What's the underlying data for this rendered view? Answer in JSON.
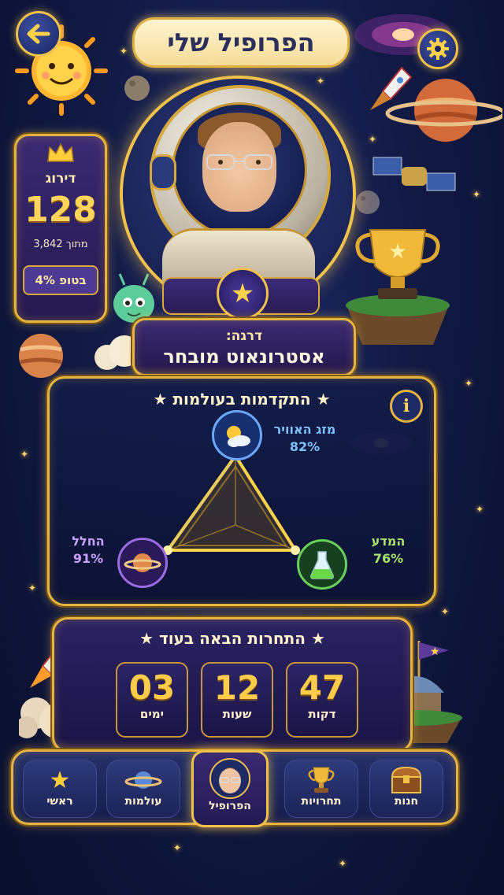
{
  "header": {
    "title": "הפרופיל שלי",
    "back_icon": "arrow-left-icon",
    "settings_icon": "gear-icon"
  },
  "rank": {
    "label": "דירוג",
    "value": "128",
    "out_of": "מתוך 3,842",
    "top_percent": "בטופ 4%"
  },
  "player": {
    "rank_title_label": "דרגה:",
    "rank_title": "אסטרונאוט מובחר"
  },
  "worlds_progress": {
    "title": "★ התקדמות בעולמות ★",
    "info_label": "i",
    "weather": {
      "name": "מזג האוויר",
      "percent": "82%",
      "value": 82,
      "color": "#7fc0ff"
    },
    "space": {
      "name": "החלל",
      "percent": "91%",
      "value": 91,
      "color": "#c9a2ff"
    },
    "science": {
      "name": "המדע",
      "percent": "76%",
      "value": 76,
      "color": "#a6e36a"
    }
  },
  "countdown": {
    "title": "★ התחרות הבאה בעוד ★",
    "days": {
      "value": "03",
      "label": "ימים"
    },
    "hours": {
      "value": "12",
      "label": "שעות"
    },
    "minutes": {
      "value": "47",
      "label": "דקות"
    }
  },
  "nav": {
    "items": [
      {
        "label": "חנות",
        "icon": "treasure-chest-icon"
      },
      {
        "label": "תחרויות",
        "icon": "trophy-icon"
      },
      {
        "label": "הפרופיל",
        "icon": "avatar-icon",
        "active": true
      },
      {
        "label": "עולמות",
        "icon": "planet-icon"
      },
      {
        "label": "ראשי",
        "icon": "star-icon"
      }
    ]
  }
}
